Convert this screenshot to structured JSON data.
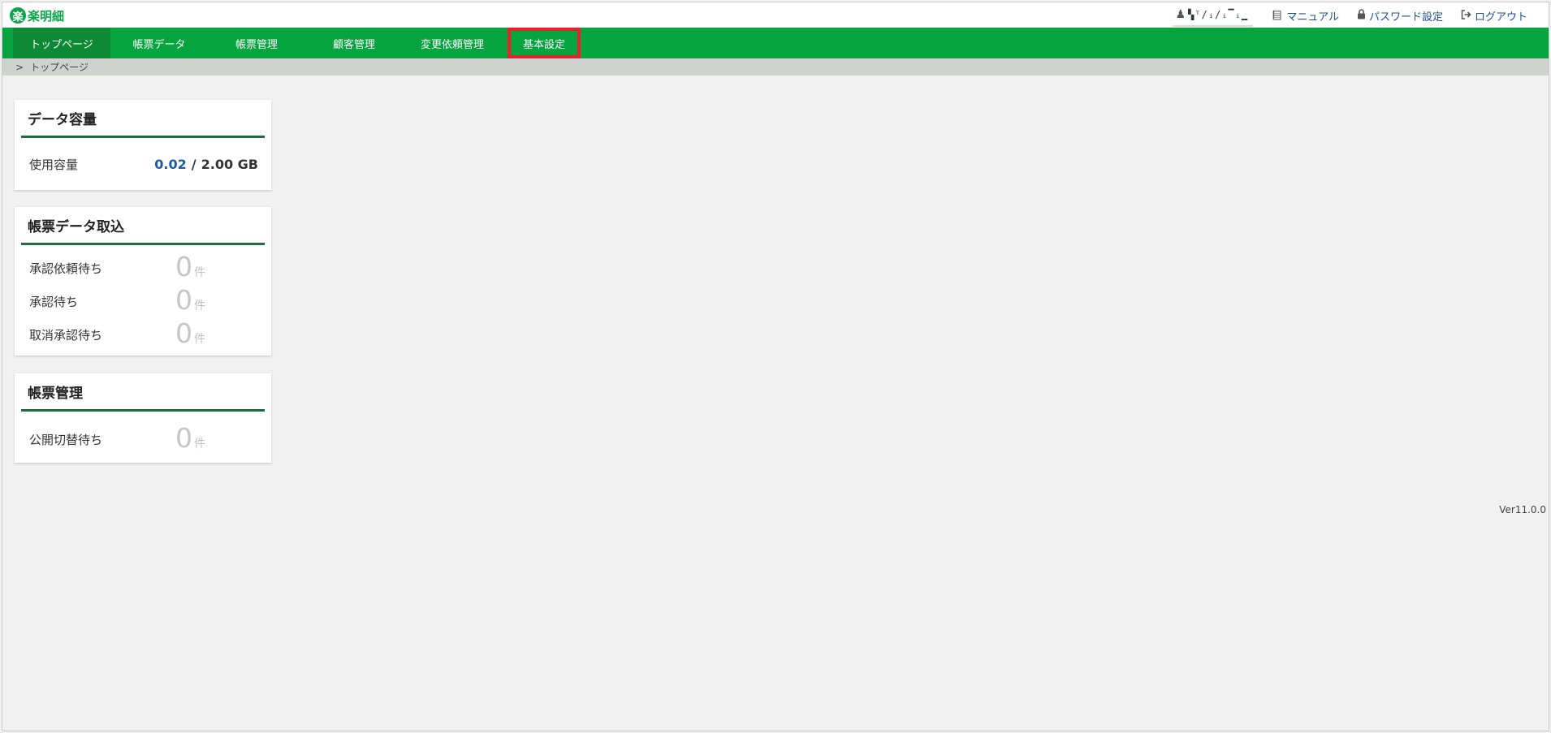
{
  "header": {
    "logo_mark": "楽",
    "logo_text": "楽明細",
    "user_name": "▚ᵀ/ᵢ/ᵢ▔ᵢ▁",
    "links": {
      "manual": "マニュアル",
      "password": "パスワード設定",
      "logout": "ログアウト"
    }
  },
  "nav": {
    "items": [
      {
        "label": "トップページ"
      },
      {
        "label": "帳票データ"
      },
      {
        "label": "帳票管理"
      },
      {
        "label": "顧客管理"
      },
      {
        "label": "変更依頼管理"
      },
      {
        "label": "基本設定"
      }
    ]
  },
  "breadcrumb": {
    "separator": ">",
    "current": "トップページ"
  },
  "cards": {
    "storage": {
      "title": "データ容量",
      "label": "使用容量",
      "used": "0.02",
      "separator": "/",
      "total": "2.00 GB"
    },
    "import": {
      "title": "帳票データ取込",
      "rows": [
        {
          "label": "承認依頼待ち",
          "count": "0",
          "unit": "件"
        },
        {
          "label": "承認待ち",
          "count": "0",
          "unit": "件"
        },
        {
          "label": "取消承認待ち",
          "count": "0",
          "unit": "件"
        }
      ]
    },
    "management": {
      "title": "帳票管理",
      "rows": [
        {
          "label": "公開切替待ち",
          "count": "0",
          "unit": "件"
        }
      ]
    }
  },
  "footer": {
    "version": "Ver11.0.0"
  },
  "colors": {
    "nav_bg": "#05a43e",
    "nav_active": "#0e8a36",
    "highlight": "#e8212b",
    "accent_blue": "#1d5aa5",
    "card_rule": "#1f6b39"
  }
}
